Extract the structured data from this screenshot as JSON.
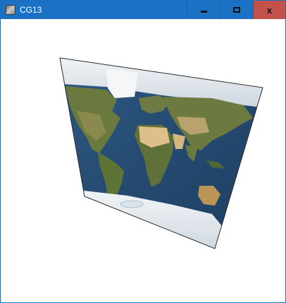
{
  "window": {
    "title": "CG13",
    "controls": {
      "minimize": "minimize",
      "maximize": "maximize",
      "close": "x"
    }
  },
  "colors": {
    "titlebar": "#1b72c5",
    "close_button": "#c4524c",
    "ocean": "#23476d",
    "land": "#6b7a3c",
    "desert": "#d8bf8c",
    "ice": "#e9eef2",
    "canvas": "#ffffff"
  },
  "scene": {
    "object": "world-map-texture-quad",
    "icons": [
      "app-icon",
      "minimize-icon",
      "maximize-icon",
      "close-icon"
    ]
  }
}
